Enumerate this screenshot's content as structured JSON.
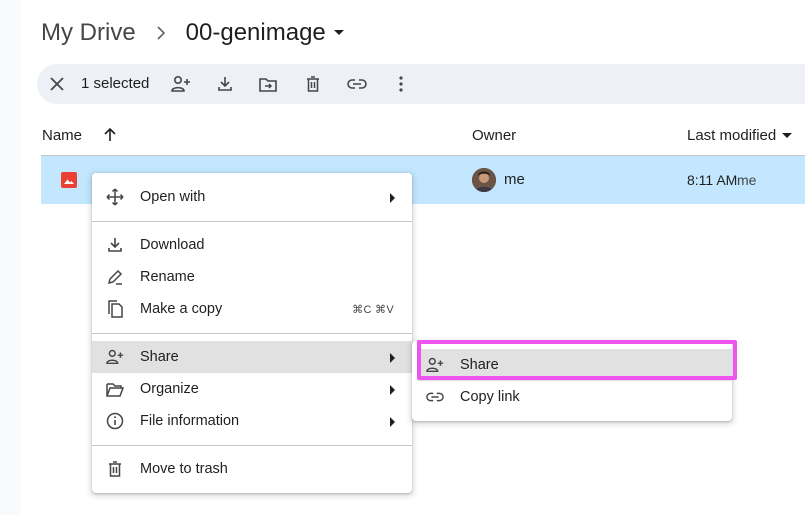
{
  "breadcrumb": {
    "root": "My Drive",
    "current": "00-genimage"
  },
  "toolbar": {
    "selected_text": "1 selected",
    "icons": [
      "close-icon",
      "share-icon",
      "download-icon",
      "move-icon",
      "trash-icon",
      "link-icon",
      "more-icon"
    ]
  },
  "columns": {
    "name": "Name",
    "owner": "Owner",
    "last_modified": "Last modified"
  },
  "file": {
    "owner": "me",
    "modified_time": "8:11 AM",
    "modified_by": "me",
    "icon_color": "#e94235"
  },
  "context_menu": {
    "open_with": "Open with",
    "download": "Download",
    "rename": "Rename",
    "make_copy": "Make a copy",
    "make_copy_shortcut": "⌘C ⌘V",
    "share": "Share",
    "organize": "Organize",
    "file_information": "File information",
    "move_to_trash": "Move to trash"
  },
  "share_submenu": {
    "share": "Share",
    "copy_link": "Copy link"
  },
  "colors": {
    "selected_row": "#c2e7ff",
    "toolbar_bg": "#edf1f7",
    "highlight_border": "#ee55ee",
    "menu_hover": "#e1e1e1"
  }
}
